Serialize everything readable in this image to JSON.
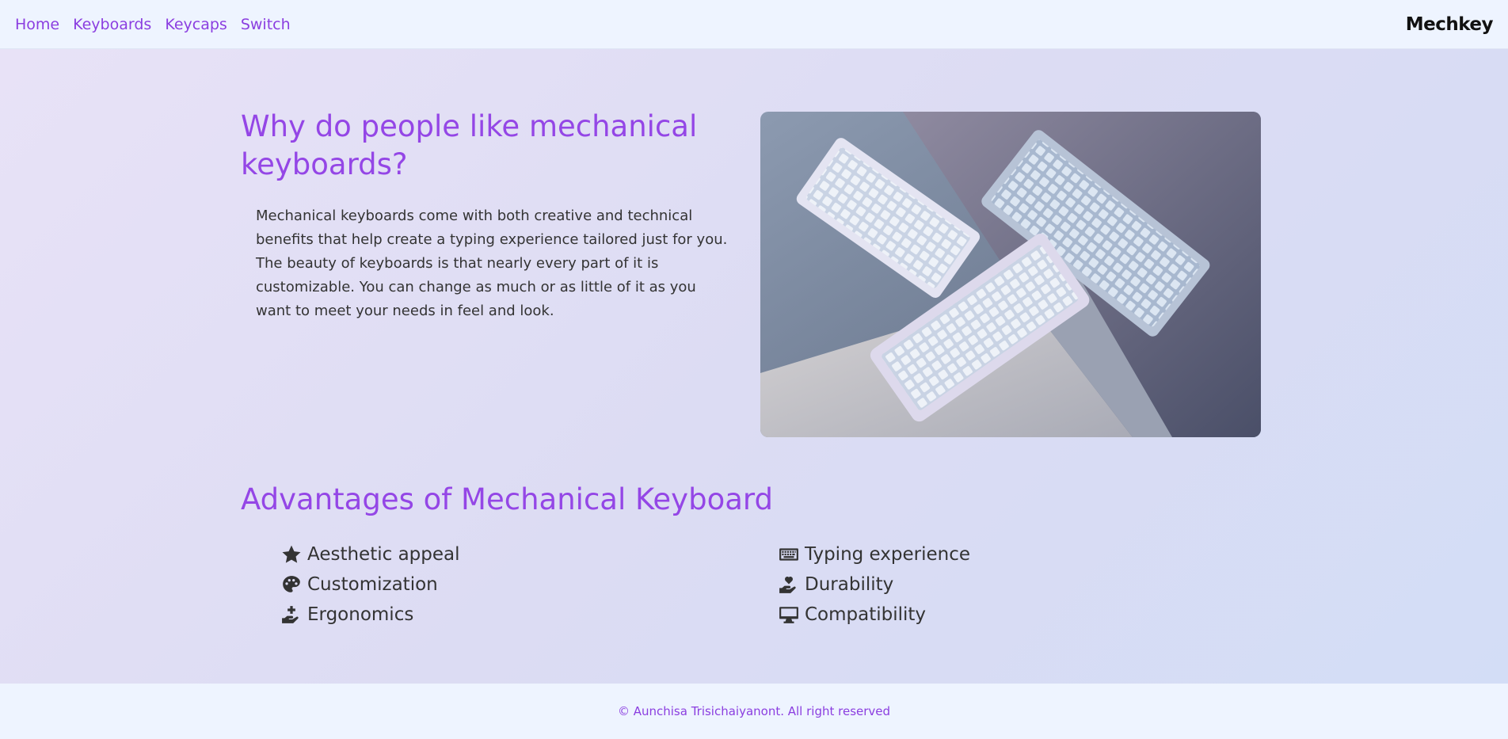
{
  "nav": {
    "links": [
      {
        "label": "Home"
      },
      {
        "label": "Keyboards"
      },
      {
        "label": "Keycaps"
      },
      {
        "label": "Switch"
      }
    ],
    "brand": "Mechkey"
  },
  "hero": {
    "title": "Why do people like mechanical keyboards?",
    "paragraph": "Mechanical keyboards come with both creative and technical benefits that help create a typing experience tailored just for you. The beauty of keyboards is that nearly every part of it is customizable. You can change as much or as little of it as you want to meet your needs in feel and look.",
    "image_subject": "three mechanical keyboards on grey and lavender steps"
  },
  "advantages": {
    "title": "Advantages of Mechanical Keyboard",
    "items": [
      {
        "label": "Aesthetic appeal",
        "icon": "star-icon"
      },
      {
        "label": "Customization",
        "icon": "palette-icon"
      },
      {
        "label": "Ergonomics",
        "icon": "hand-plus-icon"
      },
      {
        "label": "Typing experience",
        "icon": "keyboard-icon"
      },
      {
        "label": "Durability",
        "icon": "hand-heart-icon"
      },
      {
        "label": "Compatibility",
        "icon": "monitor-icon"
      }
    ]
  },
  "footer": {
    "text": "© Aunchisa Trisichaiyanont. All right reserved"
  },
  "colors": {
    "accent": "#9446e6",
    "nav_bg": "#eef4ff",
    "text": "#333333"
  }
}
